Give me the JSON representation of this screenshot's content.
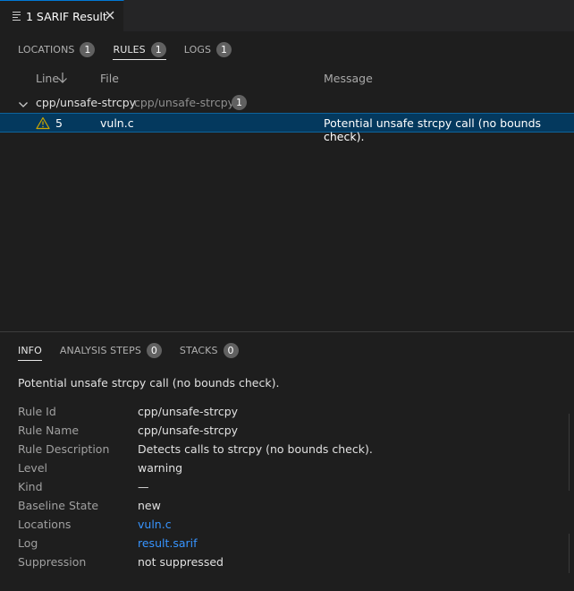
{
  "editor_tab": {
    "title": "1 SARIF Result",
    "icon": "list-icon",
    "close_icon": "close-icon"
  },
  "view_tabs": [
    {
      "label": "LOCATIONS",
      "count": "1",
      "active": false
    },
    {
      "label": "RULES",
      "count": "1",
      "active": true
    },
    {
      "label": "LOGS",
      "count": "1",
      "active": false
    }
  ],
  "columns": {
    "line": "Line",
    "file": "File",
    "message": "Message"
  },
  "group": {
    "name": "cpp/unsafe-strcpy",
    "description": "cpp/unsafe-strcpy",
    "count": "1"
  },
  "result": {
    "line": "5",
    "file": "vuln.c",
    "message": "Potential unsafe strcpy call (no bounds check)."
  },
  "info_tabs": [
    {
      "label": "INFO",
      "count": null,
      "active": true
    },
    {
      "label": "ANALYSIS STEPS",
      "count": "0",
      "active": false
    },
    {
      "label": "STACKS",
      "count": "0",
      "active": false
    }
  ],
  "info": {
    "message": "Potential unsafe strcpy call (no bounds check).",
    "properties": [
      {
        "key": "Rule Id",
        "value": "cpp/unsafe-strcpy",
        "link": false
      },
      {
        "key": "Rule Name",
        "value": "cpp/unsafe-strcpy",
        "link": false
      },
      {
        "key": "Rule Description",
        "value": "Detects calls to strcpy (no bounds check).",
        "link": false
      },
      {
        "key": "Level",
        "value": "warning",
        "link": false
      },
      {
        "key": "Kind",
        "value": "—",
        "link": false
      },
      {
        "key": "Baseline State",
        "value": "new",
        "link": false
      },
      {
        "key": "Locations",
        "value": "vuln.c",
        "link": true
      },
      {
        "key": "Log",
        "value": "result.sarif",
        "link": true
      },
      {
        "key": "Suppression",
        "value": "not suppressed",
        "link": false
      }
    ]
  },
  "colors": {
    "background": "#1e1e1e",
    "selected_row": "#04395e",
    "warning": "#cca700",
    "link": "#3794ff",
    "badge": "#616161"
  }
}
